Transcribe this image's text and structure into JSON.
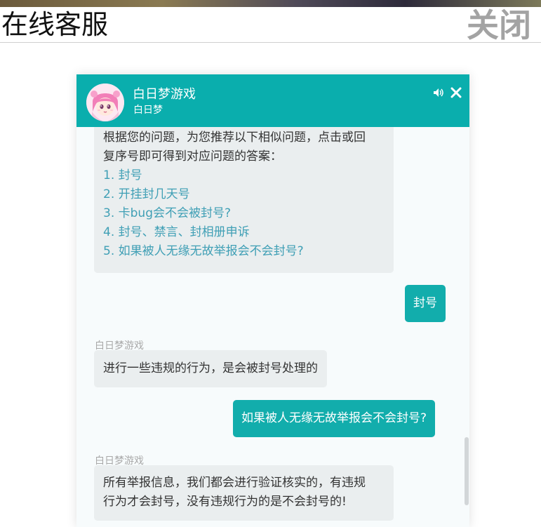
{
  "page": {
    "title": "在线客服",
    "close_label": "关闭"
  },
  "chat": {
    "agent_name": "白日梦游戏",
    "agent_sub": "白日梦",
    "colors": {
      "header_bg": "#0aaead",
      "user_bubble_bg": "#12adac",
      "bot_bubble_bg": "#eaeeef",
      "link_color": "#3f9fb5"
    },
    "header_icons": [
      "sound-icon",
      "close-icon"
    ],
    "messages": {
      "suggestions_intro_line1": "根据您的问题，为您推荐以下相似问题，点击或回",
      "suggestions_intro_line2": "复序号即可得到对应问题的答案：",
      "suggestions": [
        "1. 封号",
        "2. 开挂封几天号",
        "3. 卡bug会不会被封号?",
        "4. 封号、禁言、封相册申诉",
        "5. 如果被人无缘无故举报会不会封号?"
      ],
      "user_msg_1": "封号",
      "bot_sender_1": "白日梦游戏",
      "bot_msg_1": "进行一些违规的行为，是会被封号处理的",
      "user_msg_2": "如果被人无缘无故举报会不会封号?",
      "bot_sender_2": "白日梦游戏",
      "bot_msg_2_line1": "所有举报信息，我们都会进行验证核实的，有违规",
      "bot_msg_2_line2": "行为才会封号，没有违规行为的是不会封号的!"
    }
  }
}
